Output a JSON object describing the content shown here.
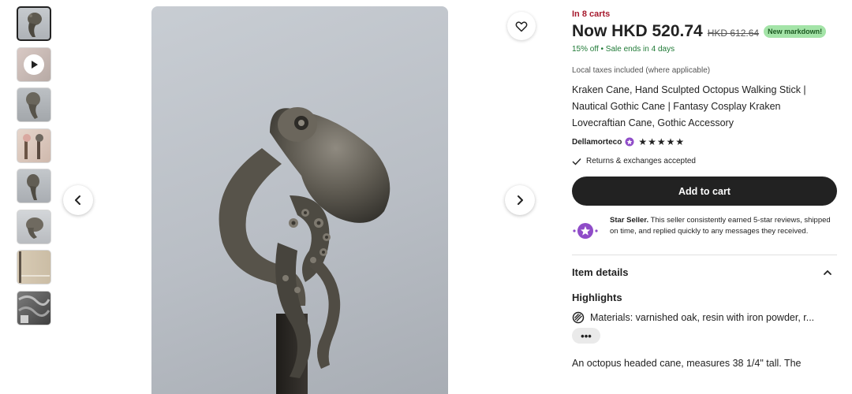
{
  "gallery": {
    "thumbnails": [
      {
        "kind": "image",
        "icon": "octopus-cane-thumb",
        "active": true
      },
      {
        "kind": "video",
        "icon": "play-icon"
      },
      {
        "kind": "image",
        "icon": "octopus-cane-thumb"
      },
      {
        "kind": "image",
        "icon": "octopus-cane-thumb"
      },
      {
        "kind": "image",
        "icon": "octopus-cane-thumb"
      },
      {
        "kind": "image",
        "icon": "octopus-cane-thumb"
      },
      {
        "kind": "image",
        "icon": "cane-shaft-thumb"
      },
      {
        "kind": "image",
        "icon": "cane-pattern-thumb"
      }
    ],
    "prev_icon": "chevron-left-icon",
    "next_icon": "chevron-right-icon",
    "favorite_icon": "heart-icon"
  },
  "listing": {
    "in_carts": "In 8 carts",
    "price_now": "Now HKD 520.74",
    "price_old": "HKD 612.64",
    "badge": "New markdown!",
    "sale_info": "15% off  •  Sale ends in 4 days",
    "taxes": "Local taxes included (where applicable)",
    "title": "Kraken Cane, Hand Sculpted Octopus Walking Stick | Nautical Gothic Cane | Fantasy Cosplay Kraken Lovecraftian Cane, Gothic Accessory",
    "seller": "Dellamorteco",
    "rating_stars": "★★★★★",
    "returns": "Returns & exchanges accepted",
    "add_to_cart": "Add to cart",
    "star_seller_label": "Star Seller.",
    "star_seller_text": " This seller consistently earned 5-star reviews, shipped on time, and replied quickly to any messages they received.",
    "item_details": "Item details",
    "highlights": "Highlights",
    "materials": "Materials: varnished oak, resin with iron powder, r...",
    "more": "•••",
    "description": "An octopus headed cane, measures 38 1/4\" tall. The"
  },
  "colors": {
    "in_carts": "#a61a2e",
    "sale": "#1f7a36",
    "badge_bg": "#a4e4a8",
    "star_seller": "#8f4cc8",
    "button": "#222222"
  }
}
